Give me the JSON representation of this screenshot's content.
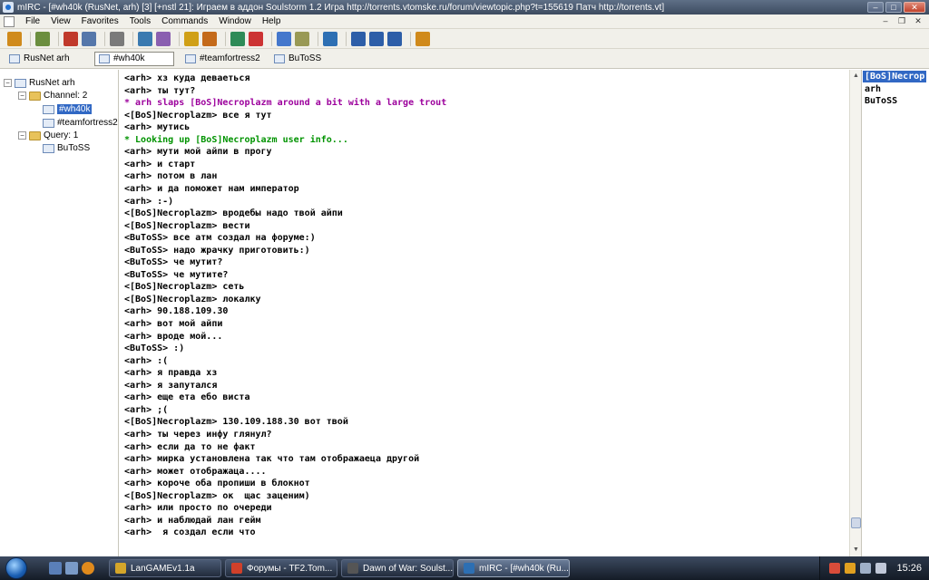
{
  "window": {
    "title": "mIRC - [#wh40k (RusNet, arh) [3] [+nstl 21]: Играем в аддон Soulstorm 1.2 Игра http://torrents.vtomske.ru/forum/viewtopic.php?t=155619 Патч http://torrents.vt]"
  },
  "menu": [
    "File",
    "View",
    "Favorites",
    "Tools",
    "Commands",
    "Window",
    "Help"
  ],
  "toolbar": {
    "icons": [
      "connect-icon",
      "options-icon",
      "favorites-icon",
      "address-book-icon",
      "channels-list-icon",
      "scripts-icon",
      "timer-icon",
      "colors-icon",
      "dcc-send-icon",
      "dcc-chat-icon",
      "notify-icon",
      "url-list-icon",
      "log-icon",
      "receive-icon",
      "tile-icon",
      "cascade-icon",
      "arrange-icon",
      "help-icon"
    ],
    "colors": [
      "#d08a1c",
      "#6b8e3e",
      "#c0392b",
      "#5577aa",
      "#7a7a7a",
      "#3a7ab0",
      "#8a5fb0",
      "#d0a017",
      "#c46a1a",
      "#2e8b57",
      "#cc3333",
      "#4477cc",
      "#999955",
      "#2d6fb3",
      "#2d5ea8",
      "#2d5ea8",
      "#2d5ea8",
      "#d08a1c"
    ]
  },
  "switchbar": {
    "items": [
      {
        "label": "RusNet arh",
        "active": false
      },
      {
        "label": "#wh40k",
        "active": true
      },
      {
        "label": "#teamfortress2",
        "active": false
      },
      {
        "label": "BuToSS",
        "active": false
      }
    ]
  },
  "tree": {
    "network": "RusNet arh",
    "channel_group": "Channel: 2",
    "channels": [
      "#wh40k",
      "#teamfortress2"
    ],
    "query_group": "Query: 1",
    "queries": [
      "BuToSS"
    ]
  },
  "chat": {
    "lines": [
      {
        "text": "<arh> хз куда деваеться",
        "kind": "normal"
      },
      {
        "text": "<arh> ты тут?",
        "kind": "normal"
      },
      {
        "text": "* arh slaps [BoS]Necroplazm around a bit with a large trout",
        "kind": "action"
      },
      {
        "text": "<[BoS]Necroplazm> все я тут",
        "kind": "normal"
      },
      {
        "text": "<arh> мутись",
        "kind": "normal"
      },
      {
        "text": "* Looking up [BoS]Necroplazm user info...",
        "kind": "info"
      },
      {
        "text": "<arh> мути мой айпи в прогу",
        "kind": "normal"
      },
      {
        "text": "<arh> и старт",
        "kind": "normal"
      },
      {
        "text": "<arh> потом в лан",
        "kind": "normal"
      },
      {
        "text": "<arh> и да поможет нам император",
        "kind": "normal"
      },
      {
        "text": "<arh> :-)",
        "kind": "normal"
      },
      {
        "text": "<[BoS]Necroplazm> вродебы надо твой айпи",
        "kind": "normal"
      },
      {
        "text": "<[BoS]Necroplazm> вести",
        "kind": "normal"
      },
      {
        "text": "<BuToSS> все атм создал на форуме:)",
        "kind": "normal"
      },
      {
        "text": "<BuToSS> надо жрачку приготовить:)",
        "kind": "normal"
      },
      {
        "text": "<BuToSS> че мутит?",
        "kind": "normal"
      },
      {
        "text": "<BuToSS> че мутите?",
        "kind": "normal"
      },
      {
        "text": "<[BoS]Necroplazm> сеть",
        "kind": "normal"
      },
      {
        "text": "<[BoS]Necroplazm> локалку",
        "kind": "normal"
      },
      {
        "text": "<arh> 90.188.109.30",
        "kind": "normal"
      },
      {
        "text": "<arh> вот мой айпи",
        "kind": "normal"
      },
      {
        "text": "<arh> вроде мой...",
        "kind": "normal"
      },
      {
        "text": "<BuToSS> :)",
        "kind": "normal"
      },
      {
        "text": "<arh> :(",
        "kind": "normal"
      },
      {
        "text": "<arh> я правда хз",
        "kind": "normal"
      },
      {
        "text": "<arh> я запутался",
        "kind": "normal"
      },
      {
        "text": "<arh> еще ета ебо виста",
        "kind": "normal"
      },
      {
        "text": "<arh> ;(",
        "kind": "normal"
      },
      {
        "text": "<[BoS]Necroplazm> 130.109.188.30 вот твой",
        "kind": "normal"
      },
      {
        "text": "<arh> ты через инфу глянул?",
        "kind": "normal"
      },
      {
        "text": "<arh> если да то не факт",
        "kind": "normal"
      },
      {
        "text": "<arh> мирка установлена так что там отображаеца другой",
        "kind": "normal"
      },
      {
        "text": "<arh> может отображаца....",
        "kind": "normal"
      },
      {
        "text": "<arh> короче оба пропиши в блокнот",
        "kind": "normal"
      },
      {
        "text": "<[BoS]Necroplazm> ок  щас заценим)",
        "kind": "normal"
      },
      {
        "text": "<arh> или просто по очереди",
        "kind": "normal"
      },
      {
        "text": "<arh> и наблюдай лан гейм",
        "kind": "normal"
      },
      {
        "text": "<arh>  я создал если что",
        "kind": "normal"
      }
    ]
  },
  "nicklist": {
    "nicks": [
      {
        "nick": "[BoS]Necrop",
        "selected": true
      },
      {
        "nick": "arh",
        "selected": false
      },
      {
        "nick": "BuToSS",
        "selected": false
      }
    ]
  },
  "taskbar": {
    "tasks": [
      {
        "label": "LanGAMEv1.1a",
        "color": "#d4a62a",
        "active": false
      },
      {
        "label": "Форумы - TF2.Tom...",
        "color": "#d0402a",
        "active": false
      },
      {
        "label": "Dawn of War: Soulst...",
        "color": "#555555",
        "active": false
      },
      {
        "label": "mIRC - [#wh40k (Ru...",
        "color": "#2d6fb3",
        "active": true
      }
    ],
    "clock": "15:26"
  }
}
